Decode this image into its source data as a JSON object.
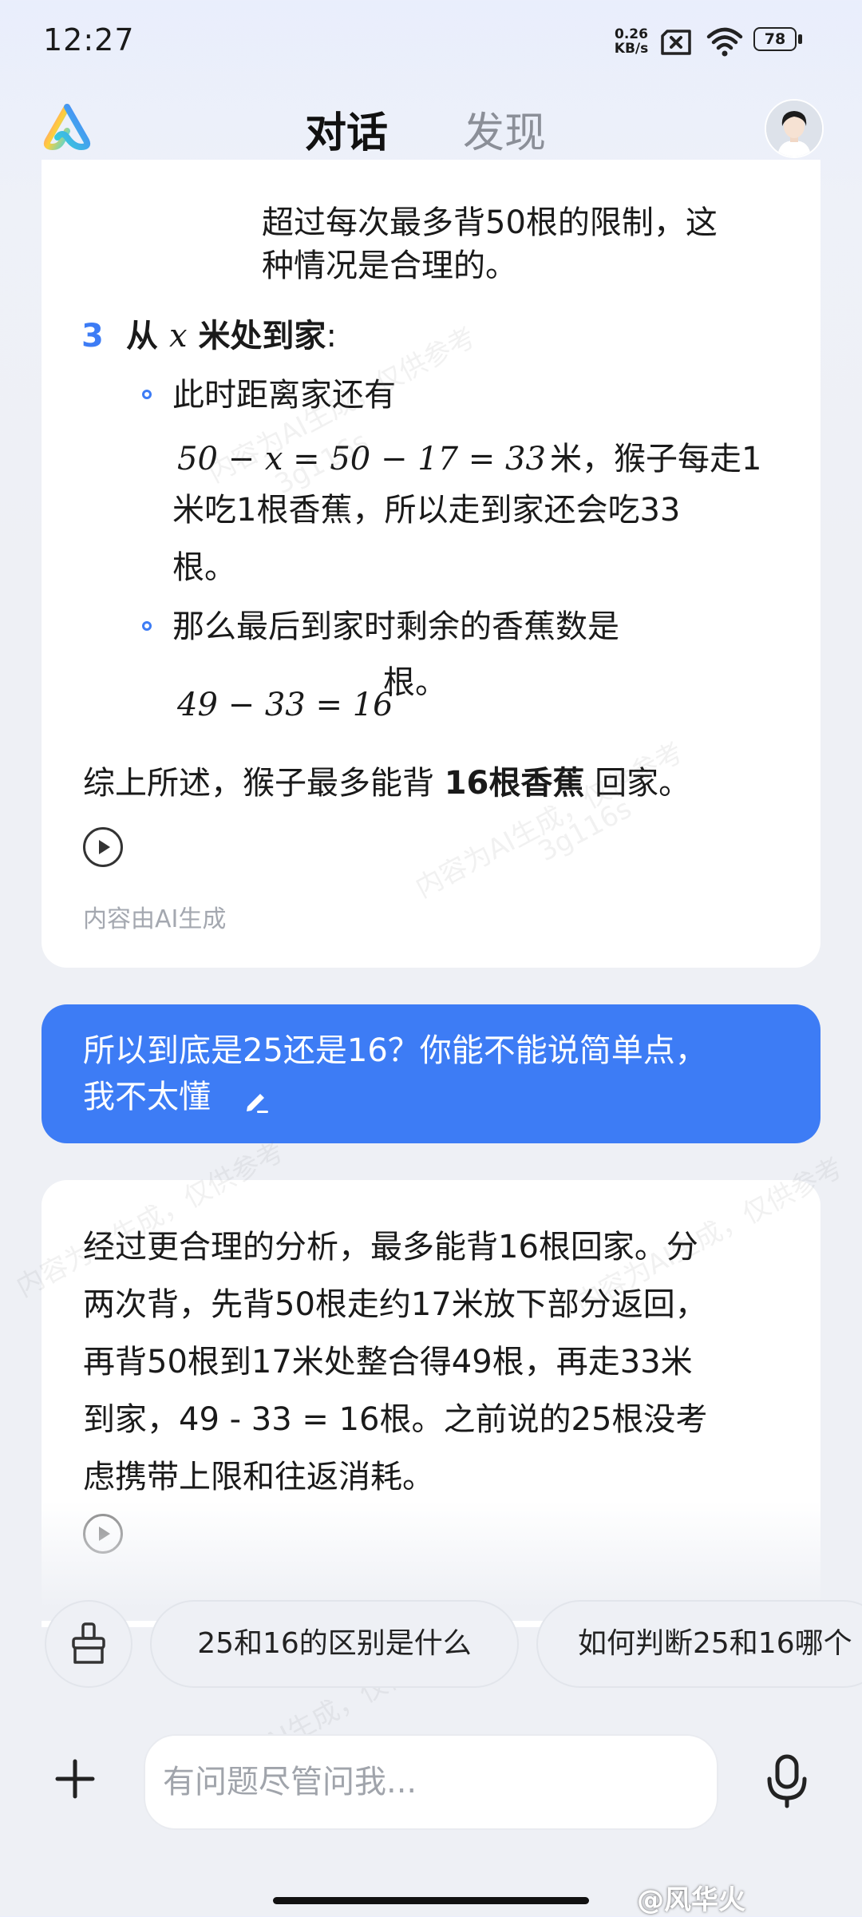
{
  "status_bar": {
    "time": "12:27",
    "net_speed_value": "0.26",
    "net_speed_unit": "KB/s",
    "battery": "78"
  },
  "header": {
    "tabs": [
      {
        "label": "对话",
        "active": true
      },
      {
        "label": "发现",
        "active": false
      }
    ]
  },
  "assistant_message_1": {
    "continued_text_line1": "超过每次最多背50根的限制，这",
    "continued_text_line2": "种情况是合理的。",
    "step_number": "3",
    "step_title_prefix": "从",
    "step_title_var": "x",
    "step_title_suffix": "米处到家",
    "step_title_colon": ":",
    "bullet1_line1": "此时距离家还有",
    "bullet1_math": "50 − x = 50 − 17 = 33",
    "bullet1_line2_after_math": "米，猴子每走1",
    "bullet1_line3": "米吃1根香蕉，所以走到家还会吃33",
    "bullet1_line4": "根。",
    "bullet2_line1": "那么最后到家时剩余的香蕉数是",
    "bullet2_math": "49 − 33 = 16",
    "bullet2_after_math": "根。",
    "summary_prefix": "综上所述，猴子最多能背 ",
    "summary_bold": "16根香蕉",
    "summary_suffix": " 回家。",
    "ai_note": "内容由AI生成"
  },
  "user_message": {
    "line1": "所以到底是25还是16？你能不能说简单点，",
    "line2": "我不太懂"
  },
  "assistant_message_2": {
    "lines": [
      "经过更合理的分析，最多能背16根回家。分",
      "两次背，先背50根走约17米放下部分返回，",
      "再背50根到17米处整合得49根，再走33米",
      "到家，49 - 33 = 16根。之前说的25根没考",
      "虑携带上限和往返消耗。"
    ]
  },
  "suggestions": [
    "25和16的区别是什么",
    "如何判断25和16哪个"
  ],
  "input": {
    "placeholder": "有问题尽管问我..."
  },
  "watermark": {
    "text": "内容为AI生成，仅供参考",
    "code": "3g116s",
    "credit": "@风华火"
  },
  "colors": {
    "accent_blue": "#3d7cf5",
    "background": "#eef0f5",
    "card": "#ffffff"
  }
}
